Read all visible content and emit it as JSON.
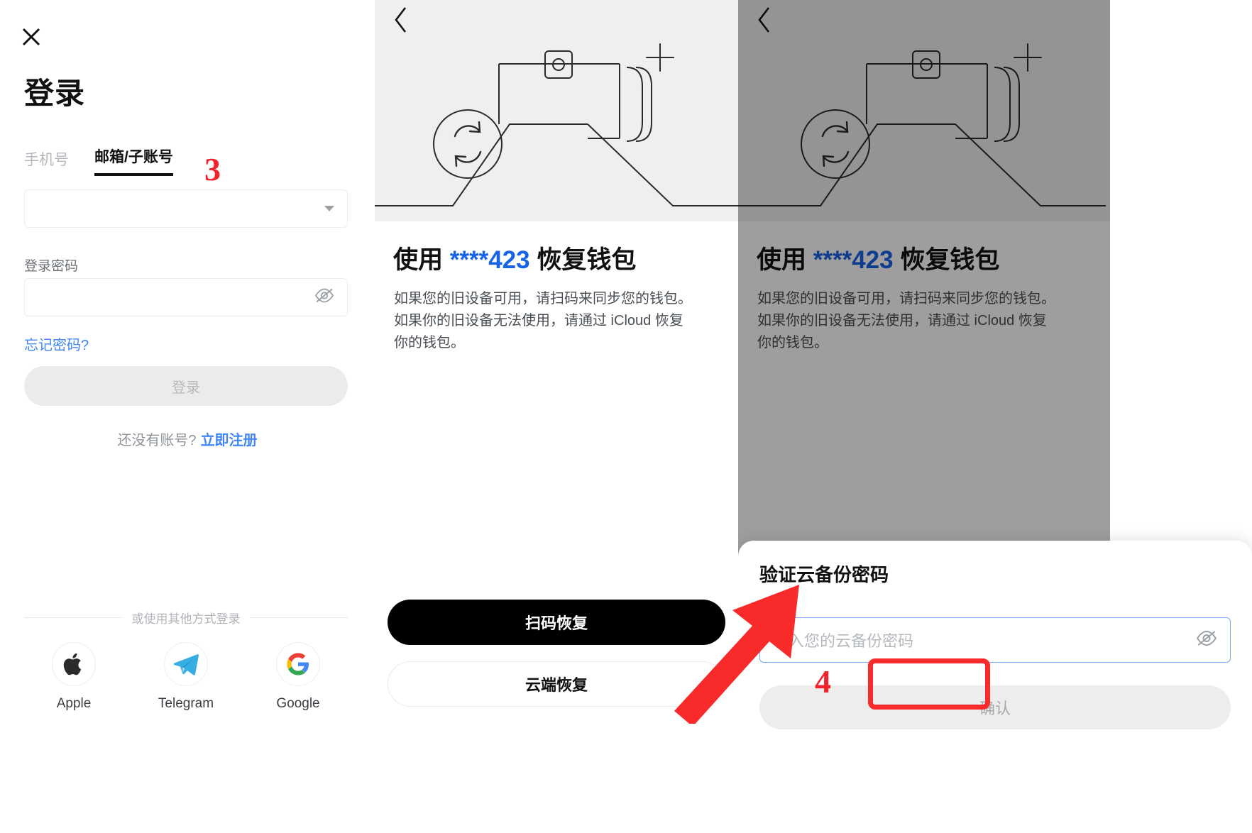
{
  "login": {
    "close_icon": "close-icon",
    "title": "登录",
    "tabs": [
      {
        "label": "手机号",
        "active": false
      },
      {
        "label": "邮箱/子账号",
        "active": true
      }
    ],
    "marker": "3",
    "account_select": {
      "value": "",
      "caret_icon": "chevron-down-icon"
    },
    "password_label": "登录密码",
    "password_input": {
      "value": "",
      "placeholder": "",
      "toggle_icon": "eye-off-icon"
    },
    "forgot_password": "忘记密码?",
    "login_button": "登录",
    "signup_prompt": "还没有账号?",
    "signup_link": "立即注册",
    "divider_text": "或使用其他方式登录",
    "social": [
      {
        "name": "Apple",
        "icon": "apple-icon"
      },
      {
        "name": "Telegram",
        "icon": "telegram-icon"
      },
      {
        "name": "Google",
        "icon": "google-icon"
      }
    ],
    "colors": {
      "link": "#4285f4",
      "marker": "#f4222d",
      "disabled_button": "#ebebeb"
    }
  },
  "recover": {
    "back_icon": "chevron-left-icon",
    "hero_icon": "wallet-sync-illustration",
    "title_prefix": "使用 ",
    "title_mask": "****423",
    "title_suffix": " 恢复钱包",
    "body_line1": "如果您的旧设备可用，请扫码来同步您的钱包。",
    "body_line2": "如果你的旧设备无法使用，请通过 iCloud 恢复",
    "body_line3": "你的钱包。",
    "scan_button": "扫码恢复",
    "cloud_button": "云端恢复",
    "marker": "4",
    "colors": {
      "mask": "#1763e8",
      "primary_button": "#000000",
      "highlight_box": "#fa2b2b"
    }
  },
  "sheet": {
    "title": "验证云备份密码",
    "password_input": {
      "value": "",
      "placeholder": "输入您的云备份密码",
      "toggle_icon": "eye-off-icon"
    },
    "confirm_button": "确认",
    "annotation_icon": "red-arrow-annotation"
  }
}
